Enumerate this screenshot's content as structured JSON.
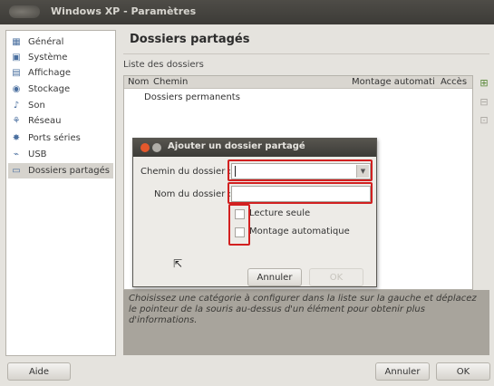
{
  "window": {
    "title": "Windows XP - Paramètres"
  },
  "sidebar": {
    "items": [
      {
        "label": "Général",
        "icon": "▦",
        "selected": false
      },
      {
        "label": "Système",
        "icon": "▣",
        "selected": false
      },
      {
        "label": "Affichage",
        "icon": "▤",
        "selected": false
      },
      {
        "label": "Stockage",
        "icon": "◉",
        "selected": false
      },
      {
        "label": "Son",
        "icon": "♪",
        "selected": false
      },
      {
        "label": "Réseau",
        "icon": "⚘",
        "selected": false
      },
      {
        "label": "Ports séries",
        "icon": "✸",
        "selected": false
      },
      {
        "label": "USB",
        "icon": "⌁",
        "selected": false
      },
      {
        "label": "Dossiers partagés",
        "icon": "▭",
        "selected": true
      }
    ]
  },
  "main": {
    "title": "Dossiers partagés",
    "list_caption": "Liste des dossiers",
    "columns": {
      "name": "Nom",
      "path": "Chemin",
      "automount": "Montage automati",
      "access": "Accès"
    },
    "rows": [
      "Dossiers permanents"
    ],
    "info_text": "Choisissez une catégorie à configurer dans la liste sur la gauche et déplacez le pointeur de la souris au-dessus d'un élément pour obtenir plus d'informations."
  },
  "footer": {
    "help": "Aide",
    "cancel": "Annuler",
    "ok": "OK"
  },
  "dialog": {
    "title": "Ajouter un dossier partagé",
    "path_label": "Chemin du dossier :",
    "path_value": "",
    "name_label": "Nom du dossier :",
    "name_value": "",
    "readonly_label": "Lecture seule",
    "automount_label": "Montage automatique",
    "readonly_checked": false,
    "automount_checked": false,
    "cancel": "Annuler",
    "ok": "OK"
  },
  "colors": {
    "highlight": "#d22020",
    "title_bar": "#3c3b37",
    "close_button": "#e3582c"
  }
}
